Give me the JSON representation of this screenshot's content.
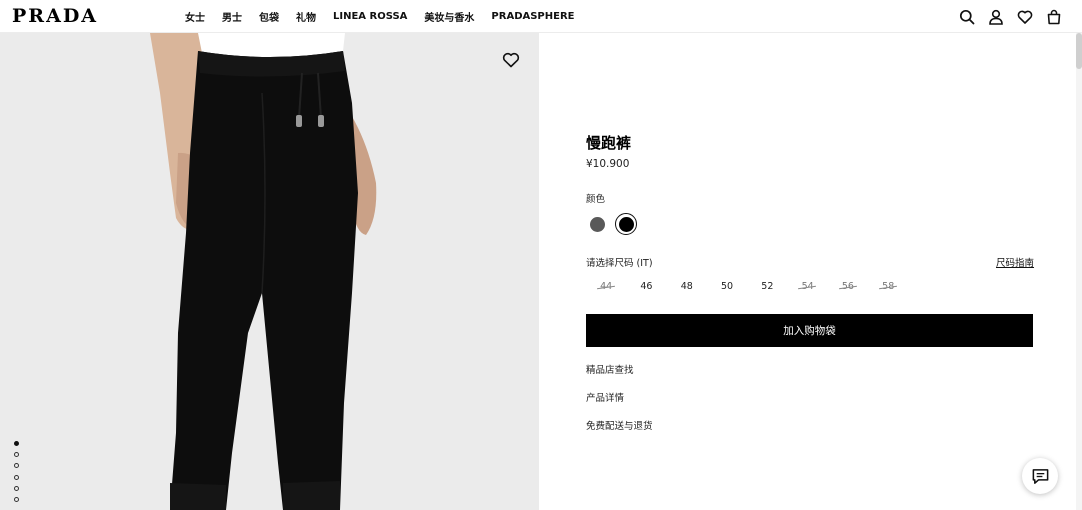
{
  "brand": {
    "logo_text": "PRADA"
  },
  "nav": {
    "items": [
      "女士",
      "男士",
      "包袋",
      "礼物",
      "LINEA ROSSA",
      "美妆与香水",
      "PRADASPHERE"
    ]
  },
  "header_icons": [
    "search-icon",
    "account-icon",
    "wishlist-icon",
    "bag-icon"
  ],
  "gallery": {
    "image_count": 6,
    "active_index": 0
  },
  "product": {
    "title": "慢跑裤",
    "price": "¥10.900",
    "color_label": "颜色",
    "colors": [
      {
        "hex": "#595959",
        "selected": false
      },
      {
        "hex": "#000000",
        "selected": true
      }
    ],
    "size_label": "请选择尺码 (IT)",
    "size_guide": "尺码指南",
    "sizes": [
      {
        "label": "44",
        "available": false
      },
      {
        "label": "46",
        "available": true
      },
      {
        "label": "48",
        "available": true
      },
      {
        "label": "50",
        "available": true
      },
      {
        "label": "52",
        "available": true
      },
      {
        "label": "54",
        "available": false
      },
      {
        "label": "56",
        "available": false
      },
      {
        "label": "58",
        "available": false
      }
    ],
    "add_to_bag": "加入购物袋",
    "links": [
      "精品店查找",
      "产品详情",
      "免费配送与退货"
    ]
  },
  "colors": {
    "accent": "#000000",
    "image_background": "#ebebeb",
    "pants": "#0d0d0d",
    "skin": "#d9b59a"
  }
}
